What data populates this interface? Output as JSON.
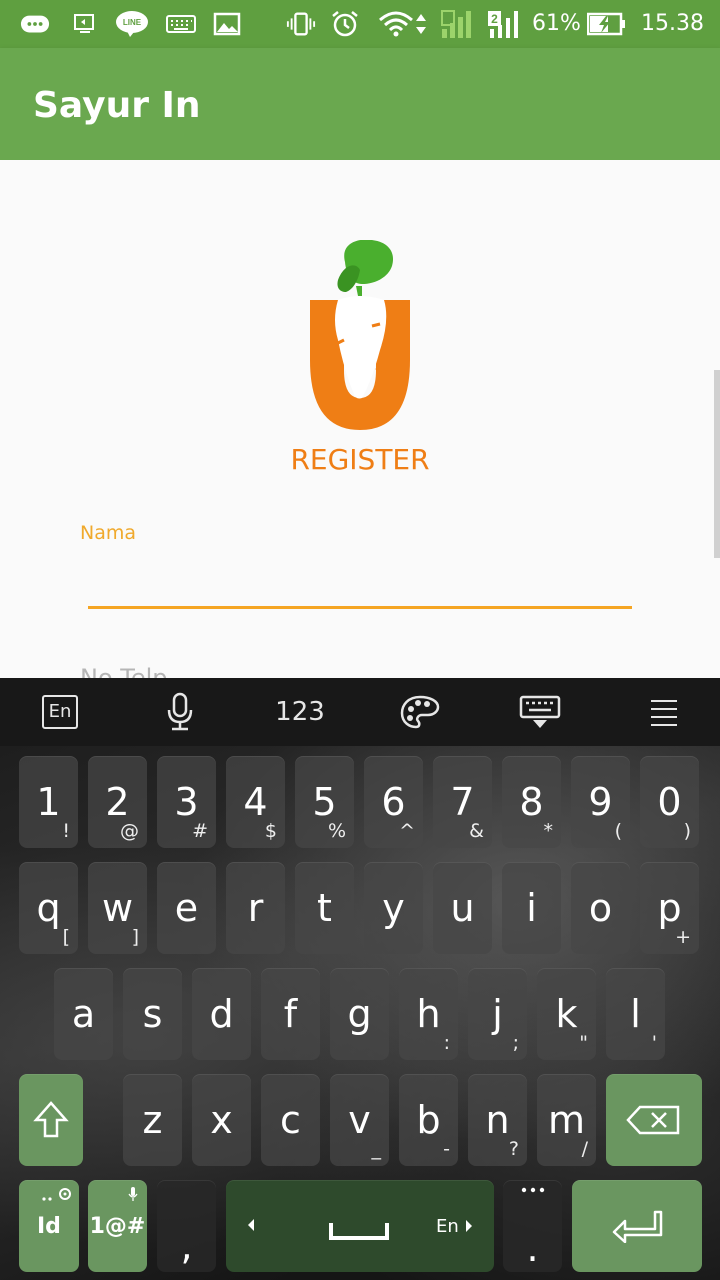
{
  "status_bar": {
    "battery": "61%",
    "time": "15.38",
    "sim2_label": "2",
    "line_label": "LINE"
  },
  "app_bar": {
    "title": "Sayur In"
  },
  "form": {
    "heading": "REGISTER",
    "name_label": "Nama",
    "name_value": "",
    "phone_label": "No Telp"
  },
  "keyboard": {
    "toolbar": {
      "lang_label": "En",
      "numbers_label": "123"
    },
    "row_numbers": [
      {
        "main": "1",
        "sub": "!"
      },
      {
        "main": "2",
        "sub": "@"
      },
      {
        "main": "3",
        "sub": "#"
      },
      {
        "main": "4",
        "sub": "$"
      },
      {
        "main": "5",
        "sub": "%"
      },
      {
        "main": "6",
        "sub": "^"
      },
      {
        "main": "7",
        "sub": "&"
      },
      {
        "main": "8",
        "sub": "*"
      },
      {
        "main": "9",
        "sub": "("
      },
      {
        "main": "0",
        "sub": ")"
      }
    ],
    "row_q": [
      {
        "main": "q",
        "sub": "["
      },
      {
        "main": "w",
        "sub": "]"
      },
      {
        "main": "e",
        "sub": ""
      },
      {
        "main": "r",
        "sub": ""
      },
      {
        "main": "t",
        "sub": ""
      },
      {
        "main": "y",
        "sub": ""
      },
      {
        "main": "u",
        "sub": ""
      },
      {
        "main": "i",
        "sub": ""
      },
      {
        "main": "o",
        "sub": ""
      },
      {
        "main": "p",
        "sub": "+"
      }
    ],
    "row_a": [
      {
        "main": "a",
        "sub": ""
      },
      {
        "main": "s",
        "sub": ""
      },
      {
        "main": "d",
        "sub": ""
      },
      {
        "main": "f",
        "sub": ""
      },
      {
        "main": "g",
        "sub": ""
      },
      {
        "main": "h",
        "sub": ":"
      },
      {
        "main": "j",
        "sub": ";"
      },
      {
        "main": "k",
        "sub": "\""
      },
      {
        "main": "l",
        "sub": "'"
      }
    ],
    "row_z": [
      {
        "main": "z",
        "sub": ""
      },
      {
        "main": "x",
        "sub": ""
      },
      {
        "main": "c",
        "sub": ""
      },
      {
        "main": "v",
        "sub": "_"
      },
      {
        "main": "b",
        "sub": "-"
      },
      {
        "main": "n",
        "sub": "?"
      },
      {
        "main": "m",
        "sub": "/"
      }
    ],
    "bottom": {
      "lang_key": "Id",
      "symbols_key": "1@#",
      "comma_key": ",",
      "space_lang": "En",
      "period_key": "."
    }
  },
  "colors": {
    "status_bar": "#5f9f40",
    "app_bar": "#6aa84f",
    "accent_orange": "#ef7e15",
    "field_underline": "#f5a523",
    "key_green": "#6a9660"
  }
}
